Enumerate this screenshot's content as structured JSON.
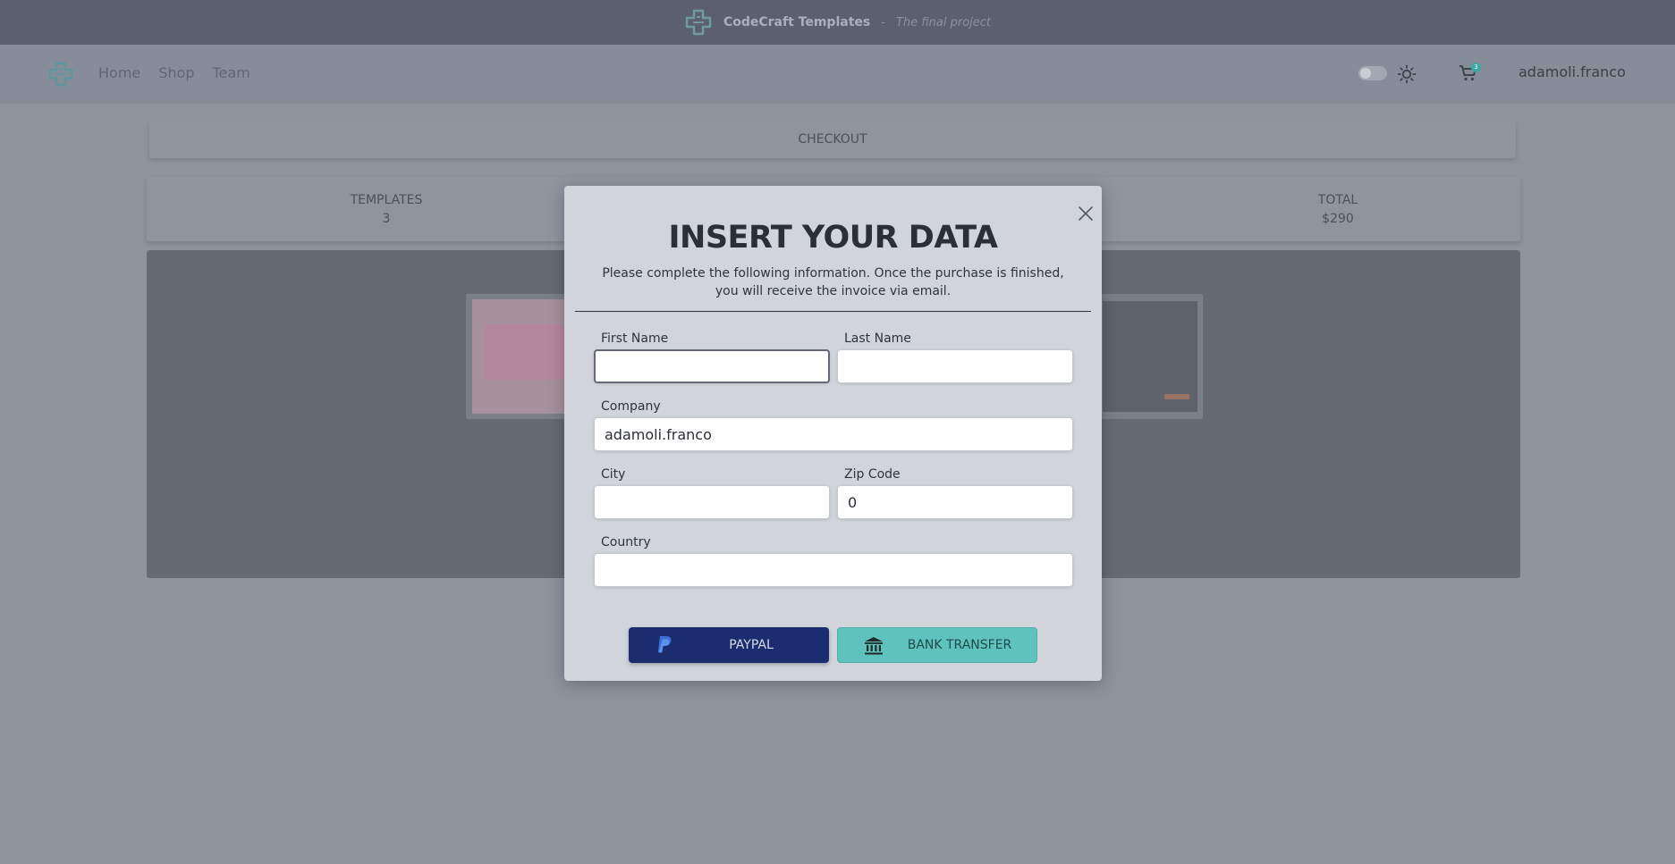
{
  "header": {
    "brand": "CodeCraft Templates",
    "separator": "-",
    "tagline": "The final project"
  },
  "nav": {
    "links": [
      "Home",
      "Shop",
      "Team"
    ],
    "cart_count": "3",
    "username": "adamoli.franco"
  },
  "checkout": {
    "title": "CHECKOUT",
    "templates_label": "TEMPLATES",
    "templates_value": "3",
    "total_label": "TOTAL",
    "total_value": "$290"
  },
  "modal": {
    "title": "INSERT YOUR DATA",
    "description": "Please complete the following information. Once the purchase is finished, you will receive the invoice via email.",
    "fields": {
      "first_name": {
        "label": "First Name",
        "value": ""
      },
      "last_name": {
        "label": "Last Name",
        "value": ""
      },
      "company": {
        "label": "Company",
        "value": "adamoli.franco"
      },
      "city": {
        "label": "City",
        "value": ""
      },
      "zip": {
        "label": "Zip Code",
        "value": "0"
      },
      "country": {
        "label": "Country",
        "value": ""
      }
    },
    "buttons": {
      "paypal": "PAYPAL",
      "bank": "BANK TRANSFER"
    }
  },
  "colors": {
    "paypal": "#1b2c6f",
    "bank": "#5fc2bd",
    "accent": "#3ba8a1"
  },
  "icons": [
    "codecraft-logo-icon",
    "sun-icon",
    "cart-icon",
    "close-icon",
    "paypal-icon",
    "bank-icon"
  ]
}
